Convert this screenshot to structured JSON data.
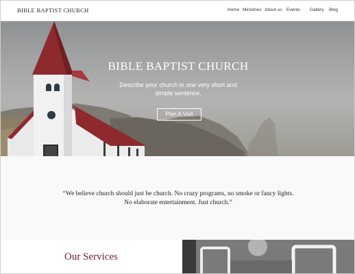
{
  "header": {
    "brand": "BIBLE BAPTIST CHURCH",
    "nav": [
      {
        "label": "Home"
      },
      {
        "label": "Ministries"
      },
      {
        "label": "About us"
      },
      {
        "label": "Events"
      },
      {
        "label": "Gallery"
      },
      {
        "label": "Blog"
      }
    ]
  },
  "hero": {
    "title": "BIBLE BAPTIST CHURCH",
    "subtitle": "Describe your church in one very short and simple sentence.",
    "cta_label": "Plan A Visit"
  },
  "quote": {
    "text": "“We believe church should just be church.  No crazy programs, no smoke or fancy lights.  No elaborate entertainment. Just church.”"
  },
  "services": {
    "title": "Our Services"
  },
  "colors": {
    "accent": "#6b1c2d",
    "roof": "#8e2a2e",
    "header_bg": "#ffffff",
    "quote_bg": "#f9f9f9"
  }
}
